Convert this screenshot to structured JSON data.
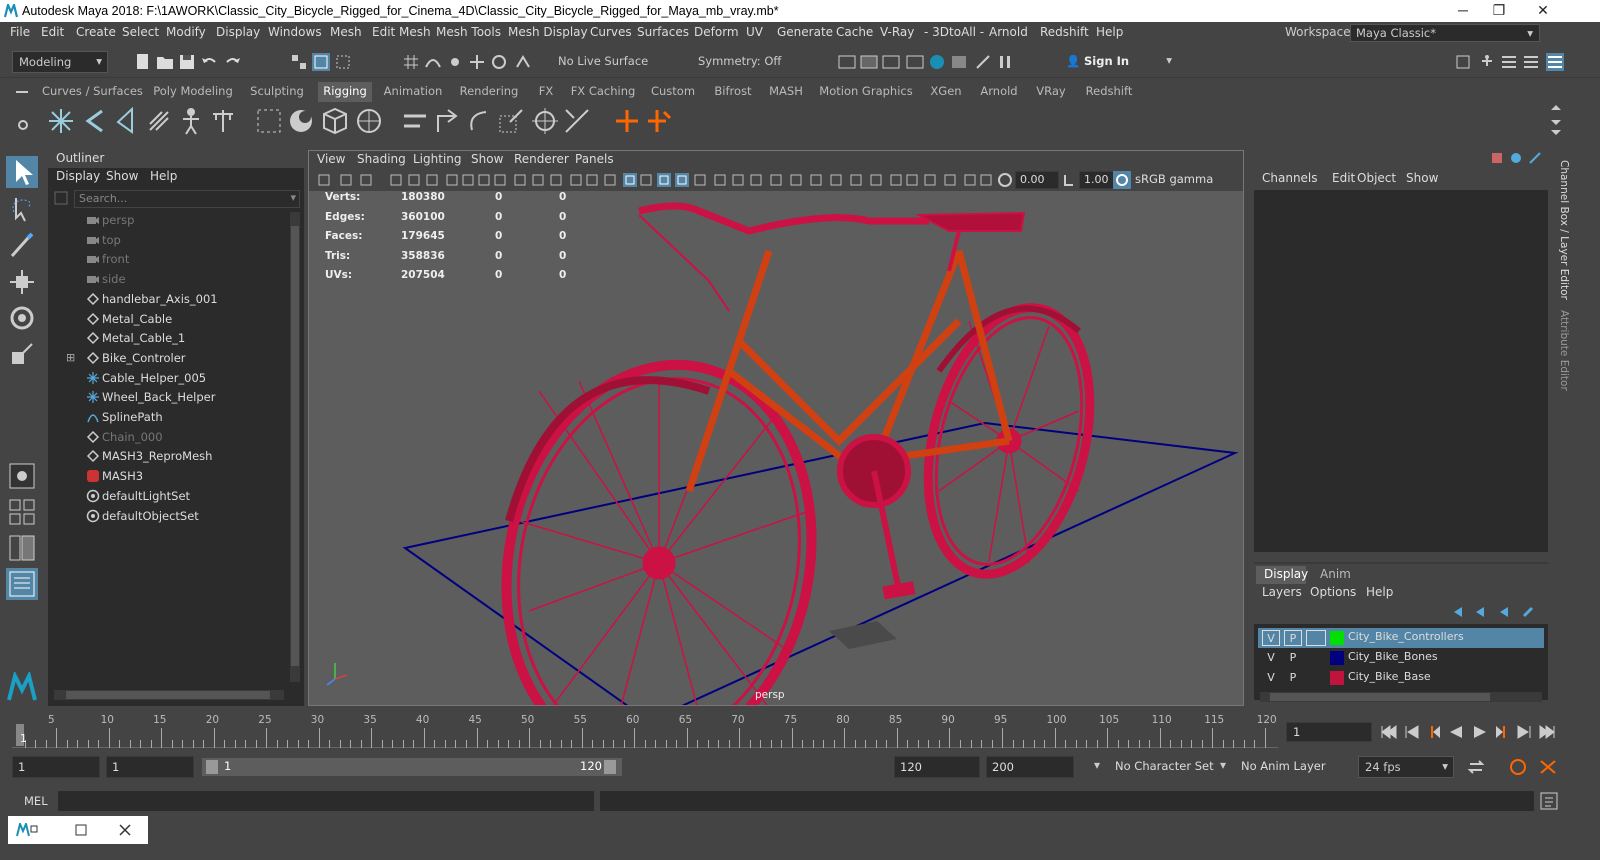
{
  "window": {
    "title": "Autodesk Maya 2018: F:\\1AWORK\\Classic_City_Bicycle_Rigged_for_Cinema_4D\\Classic_City_Bicycle_Rigged_for_Maya_mb_vray.mb*",
    "minimize": "─",
    "maximize": "❐",
    "close": "✕"
  },
  "menubar": [
    "File",
    "Edit",
    "Create",
    "Select",
    "Modify",
    "Display",
    "Windows",
    "Mesh",
    "Edit Mesh",
    "Mesh Tools",
    "Mesh Display",
    "Curves",
    "Surfaces",
    "Deform",
    "UV",
    "Generate",
    "Cache",
    "V-Ray",
    "- 3DtoAll -",
    "Arnold",
    "Redshift",
    "Help"
  ],
  "workspace": {
    "label": "Workspace :",
    "value": "Maya Classic*"
  },
  "statusline": {
    "mode": "Modeling",
    "live_surface": "No Live Surface",
    "symmetry": "Symmetry: Off",
    "sign_in": "Sign In"
  },
  "shelf_tabs": [
    "Curves / Surfaces",
    "Poly Modeling",
    "Sculpting",
    "Rigging",
    "Animation",
    "Rendering",
    "FX",
    "FX Caching",
    "Custom",
    "Bifrost",
    "MASH",
    "Motion Graphics",
    "XGen",
    "Arnold",
    "VRay",
    "Redshift"
  ],
  "shelf_active": "Rigging",
  "outliner": {
    "title": "Outliner",
    "menu": [
      "Display",
      "Show",
      "Help"
    ],
    "search_placeholder": "Search...",
    "items": [
      {
        "label": "persp",
        "icon": "camera-icon",
        "dim": true
      },
      {
        "label": "top",
        "icon": "camera-icon",
        "dim": true
      },
      {
        "label": "front",
        "icon": "camera-icon",
        "dim": true
      },
      {
        "label": "side",
        "icon": "camera-icon",
        "dim": true
      },
      {
        "label": "handlebar_Axis_001",
        "icon": "transform-icon",
        "dim": false
      },
      {
        "label": "Metal_Cable",
        "icon": "transform-icon",
        "dim": false
      },
      {
        "label": "Metal_Cable_1",
        "icon": "transform-icon",
        "dim": false
      },
      {
        "label": "Bike_Controler",
        "icon": "transform-icon",
        "dim": false,
        "expand": "⊞"
      },
      {
        "label": "Cable_Helper_005",
        "icon": "locator-icon",
        "dim": false
      },
      {
        "label": "Wheel_Back_Helper",
        "icon": "locator-icon",
        "dim": false
      },
      {
        "label": "SplinePath",
        "icon": "curve-icon",
        "dim": false
      },
      {
        "label": "Chain_000",
        "icon": "transform-icon",
        "dim": true
      },
      {
        "label": "MASH3_ReproMesh",
        "icon": "transform-icon",
        "dim": false
      },
      {
        "label": "MASH3",
        "icon": "mash-icon",
        "dim": false
      },
      {
        "label": "defaultLightSet",
        "icon": "set-icon",
        "dim": false
      },
      {
        "label": "defaultObjectSet",
        "icon": "set-icon",
        "dim": false
      }
    ]
  },
  "viewport": {
    "menu": [
      "View",
      "Shading",
      "Lighting",
      "Show",
      "Renderer",
      "Panels"
    ],
    "near": "0.00",
    "far": "1.00",
    "color_space": "sRGB gamma",
    "camera": "persp",
    "hud": [
      {
        "label": "Verts:",
        "a": "180380",
        "b": "0",
        "c": "0"
      },
      {
        "label": "Edges:",
        "a": "360100",
        "b": "0",
        "c": "0"
      },
      {
        "label": "Faces:",
        "a": "179645",
        "b": "0",
        "c": "0"
      },
      {
        "label": "Tris:",
        "a": "358836",
        "b": "0",
        "c": "0"
      },
      {
        "label": "UVs:",
        "a": "207504",
        "b": "0",
        "c": "0"
      }
    ]
  },
  "channelbox": {
    "menu": [
      "Channels",
      "Edit",
      "Object",
      "Show"
    ],
    "side_tab_1": "Channel Box / Layer Editor",
    "side_tab_2": "Attribute Editor"
  },
  "layers": {
    "tabs": [
      "Display",
      "Anim"
    ],
    "menu": [
      "Layers",
      "Options",
      "Help"
    ],
    "rows": [
      {
        "v": "V",
        "p": "P",
        "name": "City_Bike_Controllers",
        "color": "#00e000",
        "selected": true
      },
      {
        "v": "V",
        "p": "P",
        "name": "City_Bike_Bones",
        "color": "#000080",
        "selected": false
      },
      {
        "v": "V",
        "p": "P",
        "name": "City_Bike_Base",
        "color": "#c0143c",
        "selected": false
      }
    ]
  },
  "timeline": {
    "ticks": [
      "5",
      "10",
      "15",
      "20",
      "25",
      "30",
      "35",
      "40",
      "45",
      "50",
      "55",
      "60",
      "65",
      "70",
      "75",
      "80",
      "85",
      "90",
      "95",
      "100",
      "105",
      "110",
      "115",
      "120"
    ],
    "start_label": "1",
    "current_frame": "1"
  },
  "range": {
    "start": "1",
    "start2": "1",
    "slider_start": "1",
    "slider_end": "120",
    "end": "120",
    "end2": "200",
    "character_set": "No Character Set",
    "anim_layer": "No Anim Layer",
    "fps": "24 fps"
  },
  "mel": {
    "label": "MEL"
  },
  "colors": {
    "accent": "#5285a6",
    "bike": "#cc1144",
    "ground": "#000080"
  }
}
